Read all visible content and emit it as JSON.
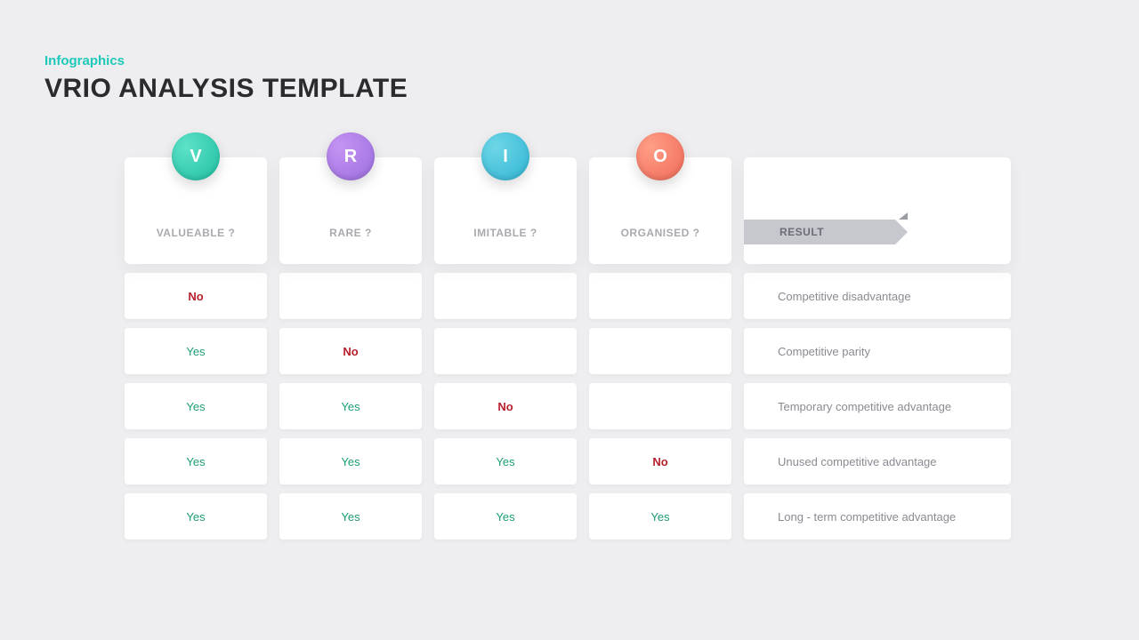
{
  "header": {
    "subtitle": "Infographics",
    "title": "VRIO ANALYSIS TEMPLATE"
  },
  "columns": [
    {
      "letter": "V",
      "label": "VALUEABLE ?"
    },
    {
      "letter": "R",
      "label": "RARE ?"
    },
    {
      "letter": "I",
      "label": "IMITABLE ?"
    },
    {
      "letter": "O",
      "label": "ORGANISED ?"
    }
  ],
  "result_label": "RESULT",
  "rows": [
    {
      "v": "No",
      "r": "",
      "i": "",
      "o": "",
      "result": "Competitive disadvantage"
    },
    {
      "v": "Yes",
      "r": "No",
      "i": "",
      "o": "",
      "result": "Competitive parity"
    },
    {
      "v": "Yes",
      "r": "Yes",
      "i": "No",
      "o": "",
      "result": "Temporary competitive advantage"
    },
    {
      "v": "Yes",
      "r": "Yes",
      "i": "Yes",
      "o": "No",
      "result": "Unused competitive advantage"
    },
    {
      "v": "Yes",
      "r": "Yes",
      "i": "Yes",
      "o": "Yes",
      "result": "Long - term competitive advantage"
    }
  ]
}
